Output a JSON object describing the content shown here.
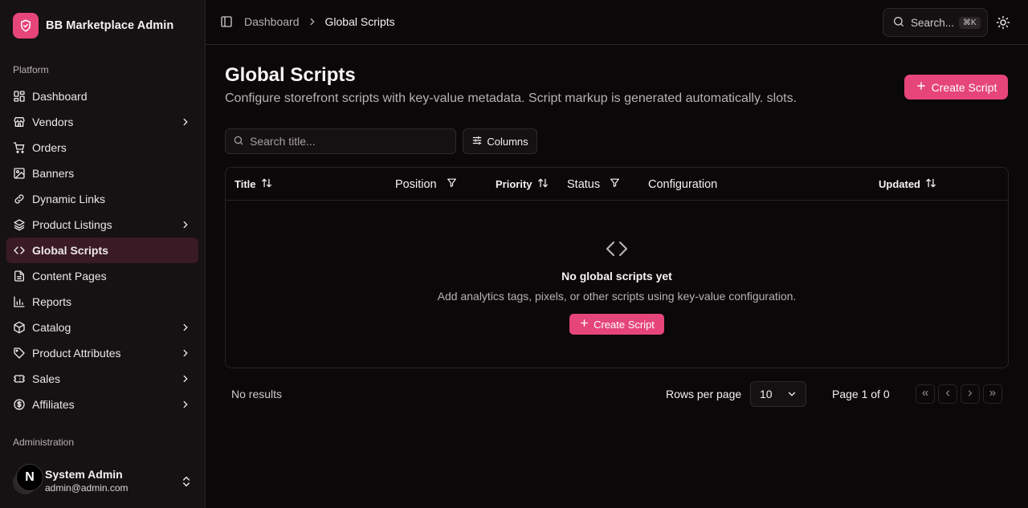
{
  "app": {
    "name": "BB Marketplace Admin",
    "logo_icon": "shield-check-icon",
    "accent_color": "#e6457a"
  },
  "sidebar": {
    "platform_label": "Platform",
    "items": [
      {
        "label": "Dashboard",
        "icon": "dashboard-icon",
        "chevron": false
      },
      {
        "label": "Vendors",
        "icon": "store-icon",
        "chevron": true
      },
      {
        "label": "Orders",
        "icon": "cart-icon",
        "chevron": false
      },
      {
        "label": "Banners",
        "icon": "image-icon",
        "chevron": false
      },
      {
        "label": "Dynamic Links",
        "icon": "link-icon",
        "chevron": false
      },
      {
        "label": "Product Listings",
        "icon": "layers-icon",
        "chevron": true
      },
      {
        "label": "Global Scripts",
        "icon": "code-icon",
        "chevron": false,
        "active": true
      },
      {
        "label": "Content Pages",
        "icon": "file-text-icon",
        "chevron": false
      },
      {
        "label": "Reports",
        "icon": "bar-chart-icon",
        "chevron": false
      },
      {
        "label": "Catalog",
        "icon": "package-icon",
        "chevron": true
      },
      {
        "label": "Product Attributes",
        "icon": "tag-icon",
        "chevron": true
      },
      {
        "label": "Sales",
        "icon": "ticket-icon",
        "chevron": true
      },
      {
        "label": "Affiliates",
        "icon": "dollar-circle-icon",
        "chevron": true
      }
    ],
    "administration_label": "Administration",
    "user": {
      "avatar_letter": "N",
      "name": "System Admin",
      "email": "admin@admin.com"
    }
  },
  "topbar": {
    "breadcrumb": [
      "Dashboard",
      "Global Scripts"
    ],
    "search_placeholder": "Search...",
    "search_shortcut": "⌘K"
  },
  "page": {
    "title": "Global Scripts",
    "description": "Configure storefront scripts with key-value metadata. Script markup is generated automatically. slots.",
    "create_button": "Create Script"
  },
  "toolbar": {
    "search_placeholder": "Search title...",
    "columns_button": "Columns"
  },
  "table": {
    "columns": [
      {
        "label": "Title",
        "control": "sort"
      },
      {
        "label": "Position",
        "control": "filter"
      },
      {
        "label": "Priority",
        "control": "sort"
      },
      {
        "label": "Status",
        "control": "filter"
      },
      {
        "label": "Configuration",
        "control": "none"
      },
      {
        "label": "Updated",
        "control": "sort"
      }
    ],
    "empty": {
      "title": "No global scripts yet",
      "description": "Add analytics tags, pixels, or other scripts using key-value configuration.",
      "button": "Create Script"
    }
  },
  "pagination": {
    "status": "No results",
    "rows_per_page_label": "Rows per page",
    "rows_per_page_value": "10",
    "page_info": "Page 1 of 0"
  }
}
